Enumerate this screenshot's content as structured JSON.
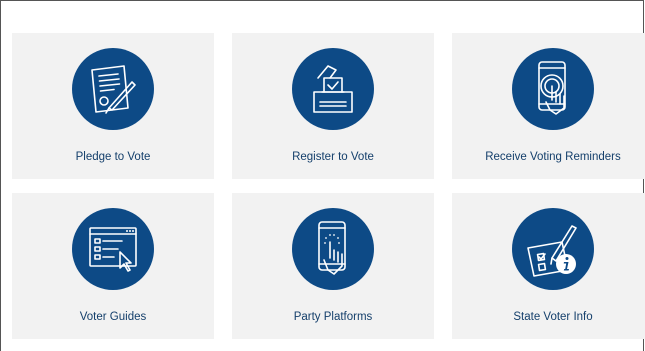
{
  "tiles": [
    {
      "label": "Pledge to Vote",
      "icon": "pledge-document-icon"
    },
    {
      "label": "Register to Vote",
      "icon": "ballot-box-icon"
    },
    {
      "label": "Receive Voting Reminders",
      "icon": "smartphone-tap-icon"
    },
    {
      "label": "Voter Guides",
      "icon": "checklist-window-icon"
    },
    {
      "label": "Party Platforms",
      "icon": "smartphone-touch-icon"
    },
    {
      "label": "State Voter Info",
      "icon": "ballot-info-icon"
    }
  ],
  "colors": {
    "icon_background": "#0d4a86",
    "tile_background": "#f2f2f2",
    "label_text": "#143f6b"
  }
}
